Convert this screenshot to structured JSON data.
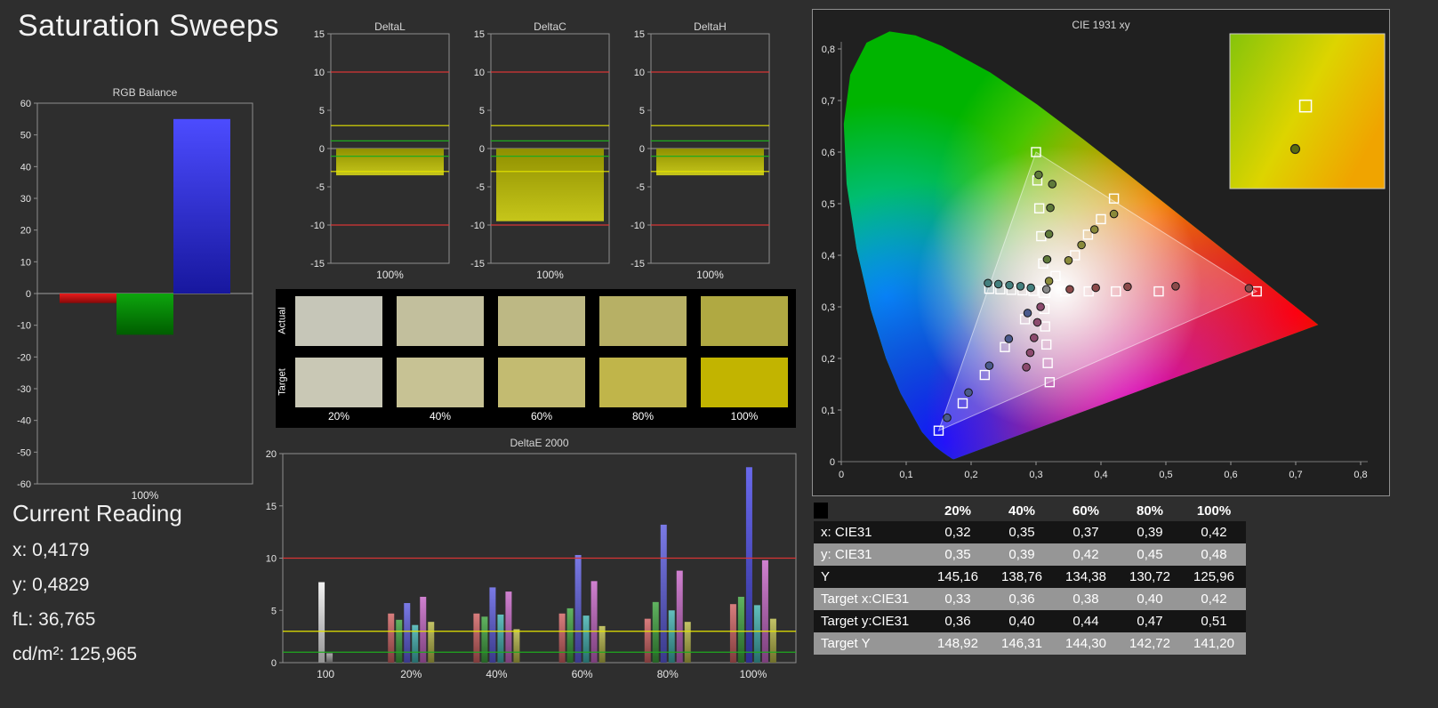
{
  "page": {
    "title": "Saturation Sweeps"
  },
  "current_reading": {
    "heading": "Current Reading",
    "lines": [
      "x: 0,4179",
      "y: 0,4829",
      "fL: 36,765",
      "cd/m²: 125,965"
    ]
  },
  "reference_lines": {
    "red": 10,
    "yellow": 3,
    "green": 1
  },
  "chart_data": [
    {
      "id": "rgb_balance",
      "type": "bar",
      "title": "RGB Balance",
      "categories": [
        "100%"
      ],
      "series": [
        {
          "name": "red",
          "color": "#e81010",
          "values": [
            -3
          ]
        },
        {
          "name": "green",
          "color": "#00a000",
          "values": [
            -13
          ]
        },
        {
          "name": "blue",
          "color": "#2525ff",
          "values": [
            55
          ]
        }
      ],
      "ylim": [
        -60,
        60
      ],
      "ytick_step": 10
    },
    {
      "id": "delta_l",
      "type": "bar",
      "title": "DeltaL",
      "categories": [
        "100%"
      ],
      "series": [
        {
          "name": "deltaL",
          "color": "#c0c000",
          "values": [
            -3.5
          ]
        }
      ],
      "ylim": [
        -15,
        15
      ],
      "ytick_step": 5,
      "reference_lines": [
        10,
        3,
        1,
        -1,
        -3,
        -10
      ]
    },
    {
      "id": "delta_c",
      "type": "bar",
      "title": "DeltaC",
      "categories": [
        "100%"
      ],
      "series": [
        {
          "name": "deltaC",
          "color": "#c0c000",
          "values": [
            -9.5
          ]
        }
      ],
      "ylim": [
        -15,
        15
      ],
      "ytick_step": 5,
      "reference_lines": [
        10,
        3,
        1,
        -1,
        -3,
        -10
      ]
    },
    {
      "id": "delta_h",
      "type": "bar",
      "title": "DeltaH",
      "categories": [
        "100%"
      ],
      "series": [
        {
          "name": "deltaH",
          "color": "#c0c000",
          "values": [
            -3.5
          ]
        }
      ],
      "ylim": [
        -15,
        15
      ],
      "ytick_step": 5,
      "reference_lines": [
        10,
        3,
        1,
        -1,
        -3,
        -10
      ]
    },
    {
      "id": "delta_e_2000",
      "type": "bar",
      "title": "DeltaE 2000",
      "ylim": [
        0,
        20
      ],
      "ytick_step": 5,
      "reference_lines": [
        10,
        3,
        1
      ],
      "groups": [
        {
          "label": "100",
          "bars": [
            {
              "name": "white",
              "color": "#efefef",
              "value": 7.7
            },
            {
              "name": "gray",
              "color": "#9a9a9a",
              "value": 0.9
            }
          ]
        },
        {
          "label": "20%",
          "bars": [
            {
              "name": "red",
              "color": "#cf6060",
              "value": 4.7
            },
            {
              "name": "green",
              "color": "#3da23d",
              "value": 4.1
            },
            {
              "name": "blue",
              "color": "#5d5de0",
              "value": 5.7
            },
            {
              "name": "cyan",
              "color": "#3fb0ae",
              "value": 3.6
            },
            {
              "name": "magenta",
              "color": "#c665c6",
              "value": 6.3
            },
            {
              "name": "yellow",
              "color": "#b5b545",
              "value": 3.9
            }
          ]
        },
        {
          "label": "40%",
          "bars": [
            {
              "name": "red",
              "color": "#cf6060",
              "value": 4.7
            },
            {
              "name": "green",
              "color": "#3da23d",
              "value": 4.4
            },
            {
              "name": "blue",
              "color": "#5d5de0",
              "value": 7.2
            },
            {
              "name": "cyan",
              "color": "#3fb0ae",
              "value": 4.6
            },
            {
              "name": "magenta",
              "color": "#c665c6",
              "value": 6.8
            },
            {
              "name": "yellow",
              "color": "#b5b545",
              "value": 3.2
            }
          ]
        },
        {
          "label": "60%",
          "bars": [
            {
              "name": "red",
              "color": "#cf6060",
              "value": 4.7
            },
            {
              "name": "green",
              "color": "#3da23d",
              "value": 5.2
            },
            {
              "name": "blue",
              "color": "#5d5de0",
              "value": 10.3
            },
            {
              "name": "cyan",
              "color": "#3fb0ae",
              "value": 4.5
            },
            {
              "name": "magenta",
              "color": "#c665c6",
              "value": 7.8
            },
            {
              "name": "yellow",
              "color": "#b5b545",
              "value": 3.5
            }
          ]
        },
        {
          "label": "80%",
          "bars": [
            {
              "name": "red",
              "color": "#cf6060",
              "value": 4.2
            },
            {
              "name": "green",
              "color": "#3da23d",
              "value": 5.8
            },
            {
              "name": "blue",
              "color": "#5d5de0",
              "value": 13.2
            },
            {
              "name": "cyan",
              "color": "#3fb0ae",
              "value": 5.0
            },
            {
              "name": "magenta",
              "color": "#c665c6",
              "value": 8.8
            },
            {
              "name": "yellow",
              "color": "#b5b545",
              "value": 3.9
            }
          ]
        },
        {
          "label": "100%",
          "bars": [
            {
              "name": "red",
              "color": "#cf6060",
              "value": 5.6
            },
            {
              "name": "green",
              "color": "#3da23d",
              "value": 6.3
            },
            {
              "name": "blue",
              "color": "#4848e8",
              "value": 18.7
            },
            {
              "name": "cyan",
              "color": "#3fb0ae",
              "value": 5.5
            },
            {
              "name": "magenta",
              "color": "#c665c6",
              "value": 9.8
            },
            {
              "name": "yellow",
              "color": "#b5b545",
              "value": 4.2
            }
          ]
        }
      ]
    }
  ],
  "swatches": {
    "row_labels": [
      "Actual",
      "Target"
    ],
    "column_labels": [
      "20%",
      "40%",
      "60%",
      "80%",
      "100%"
    ],
    "actual_colors": [
      "#c6c6b8",
      "#c2bf9d",
      "#bdb884",
      "#b7b065",
      "#b0a942"
    ],
    "target_colors": [
      "#c9c8b5",
      "#c7c294",
      "#c3bb71",
      "#c0b54a",
      "#c2b400"
    ]
  },
  "cie": {
    "title": "CIE 1931 xy",
    "xlim": [
      0,
      0.8
    ],
    "ylim": [
      0,
      0.8
    ],
    "tick_labels": [
      "0",
      "0,1",
      "0,2",
      "0,3",
      "0,4",
      "0,5",
      "0,6",
      "0,7",
      "0,8"
    ],
    "gamut_triangle": [
      [
        0.64,
        0.33
      ],
      [
        0.3,
        0.6
      ],
      [
        0.15,
        0.06
      ]
    ],
    "white_point": {
      "target": [
        0.313,
        0.329
      ],
      "measured": [
        0.316,
        0.334
      ]
    },
    "sweeps": [
      {
        "name": "red",
        "dot_color": "#8c4a4a",
        "targets": [
          [
            0.345,
            0.33
          ],
          [
            0.381,
            0.33
          ],
          [
            0.423,
            0.33
          ],
          [
            0.489,
            0.33
          ],
          [
            0.64,
            0.33
          ]
        ],
        "measured": [
          [
            0.352,
            0.334
          ],
          [
            0.392,
            0.337
          ],
          [
            0.441,
            0.339
          ],
          [
            0.515,
            0.34
          ],
          [
            0.628,
            0.336
          ]
        ]
      },
      {
        "name": "green",
        "dot_color": "#5f7a3a",
        "targets": [
          [
            0.311,
            0.384
          ],
          [
            0.308,
            0.437
          ],
          [
            0.305,
            0.491
          ],
          [
            0.302,
            0.545
          ],
          [
            0.3,
            0.6
          ]
        ],
        "measured": [
          [
            0.317,
            0.392
          ],
          [
            0.32,
            0.441
          ],
          [
            0.322,
            0.492
          ],
          [
            0.325,
            0.538
          ],
          [
            0.304,
            0.556
          ]
        ]
      },
      {
        "name": "blue",
        "dot_color": "#4a5a8c",
        "targets": [
          [
            0.283,
            0.276
          ],
          [
            0.252,
            0.222
          ],
          [
            0.221,
            0.168
          ],
          [
            0.187,
            0.113
          ],
          [
            0.15,
            0.06
          ]
        ],
        "measured": [
          [
            0.287,
            0.288
          ],
          [
            0.258,
            0.238
          ],
          [
            0.228,
            0.186
          ],
          [
            0.196,
            0.134
          ],
          [
            0.163,
            0.085
          ]
        ]
      },
      {
        "name": "cyan",
        "dot_color": "#44807e",
        "targets": [
          [
            0.296,
            0.331
          ],
          [
            0.279,
            0.332
          ],
          [
            0.262,
            0.333
          ],
          [
            0.245,
            0.334
          ],
          [
            0.228,
            0.335
          ]
        ],
        "measured": [
          [
            0.292,
            0.337
          ],
          [
            0.276,
            0.34
          ],
          [
            0.259,
            0.342
          ],
          [
            0.242,
            0.344
          ],
          [
            0.226,
            0.346
          ]
        ]
      },
      {
        "name": "magenta",
        "dot_color": "#8c4a6e",
        "targets": [
          [
            0.313,
            0.296
          ],
          [
            0.314,
            0.262
          ],
          [
            0.316,
            0.227
          ],
          [
            0.318,
            0.191
          ],
          [
            0.321,
            0.154
          ]
        ],
        "measured": [
          [
            0.307,
            0.3
          ],
          [
            0.302,
            0.27
          ],
          [
            0.297,
            0.24
          ],
          [
            0.291,
            0.211
          ],
          [
            0.285,
            0.183
          ]
        ]
      },
      {
        "name": "yellow",
        "dot_color": "#8a8a3a",
        "targets": [
          [
            0.33,
            0.36
          ],
          [
            0.36,
            0.4
          ],
          [
            0.38,
            0.44
          ],
          [
            0.4,
            0.47
          ],
          [
            0.42,
            0.51
          ]
        ],
        "measured": [
          [
            0.32,
            0.35
          ],
          [
            0.35,
            0.39
          ],
          [
            0.37,
            0.42
          ],
          [
            0.39,
            0.45
          ],
          [
            0.42,
            0.48
          ]
        ]
      }
    ],
    "inset": {
      "window_x": [
        0.38,
        0.47
      ],
      "window_y": [
        0.46,
        0.55
      ],
      "square": [
        0.424,
        0.508
      ],
      "circle": [
        0.418,
        0.483
      ]
    }
  },
  "table": {
    "columns": [
      "20%",
      "40%",
      "60%",
      "80%",
      "100%"
    ],
    "rows": [
      {
        "label": "x: CIE31",
        "values": [
          "0,32",
          "0,35",
          "0,37",
          "0,39",
          "0,42"
        ]
      },
      {
        "label": "y: CIE31",
        "values": [
          "0,35",
          "0,39",
          "0,42",
          "0,45",
          "0,48"
        ]
      },
      {
        "label": "Y",
        "values": [
          "145,16",
          "138,76",
          "134,38",
          "130,72",
          "125,96"
        ]
      },
      {
        "label": "Target x:CIE31",
        "values": [
          "0,33",
          "0,36",
          "0,38",
          "0,40",
          "0,42"
        ]
      },
      {
        "label": "Target y:CIE31",
        "values": [
          "0,36",
          "0,40",
          "0,44",
          "0,47",
          "0,51"
        ]
      },
      {
        "label": "Target Y",
        "values": [
          "148,92",
          "146,31",
          "144,30",
          "142,72",
          "141,20"
        ]
      }
    ]
  }
}
